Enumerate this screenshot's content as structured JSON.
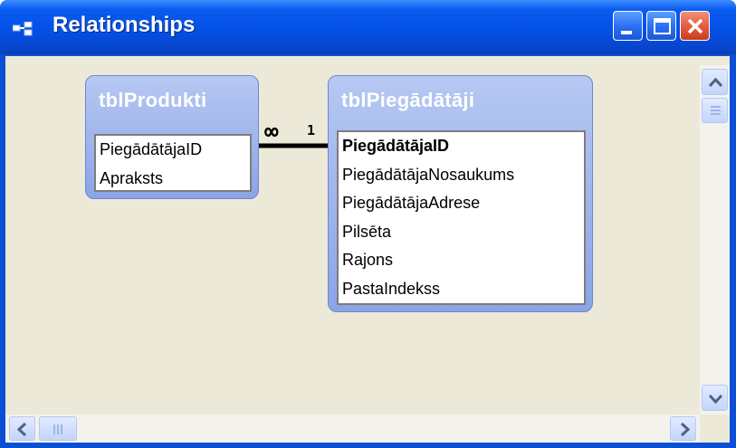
{
  "window": {
    "title": "Relationships",
    "controls": [
      "minimize",
      "maximize",
      "close"
    ]
  },
  "colors": {
    "titlebar": "#0552e8",
    "canvas": "#ece9d8",
    "table_header": "#8aa4e6",
    "close_button": "#e25a3c"
  },
  "tables": {
    "produkti": {
      "name": "tblProdukti",
      "fields": [
        "PiegādātājaID",
        "Apraksts"
      ]
    },
    "piegadataji": {
      "name": "tblPiegādātāji",
      "primary_key": "PiegādātājaID",
      "fields": [
        "PiegādātājaID",
        "PiegādātājaNosaukums",
        "PiegādātājaAdrese",
        "Pilsēta",
        "Rajons",
        "PastaIndekss"
      ]
    }
  },
  "relationship": {
    "from_table": "tblProdukti",
    "to_table": "tblPiegādātāji",
    "many_label": "∞",
    "one_label": "1"
  },
  "icons": {
    "title": "relationships-icon",
    "scroll_up": "arrow-up-icon",
    "scroll_down": "arrow-down-icon",
    "scroll_left": "arrow-left-icon",
    "scroll_right": "arrow-right-icon"
  }
}
